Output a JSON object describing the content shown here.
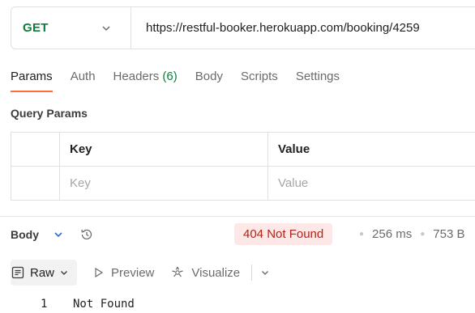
{
  "request": {
    "method": "GET",
    "url": "https://restful-booker.herokuapp.com/booking/4259"
  },
  "request_tabs": [
    {
      "label": "Params",
      "active": true
    },
    {
      "label": "Auth"
    },
    {
      "label": "Headers",
      "count": "(6)"
    },
    {
      "label": "Body"
    },
    {
      "label": "Scripts"
    },
    {
      "label": "Settings"
    }
  ],
  "query_params": {
    "title": "Query Params",
    "columns": [
      "Key",
      "Value"
    ],
    "placeholders": {
      "key": "Key",
      "value": "Value"
    }
  },
  "response": {
    "body_label": "Body",
    "status": "404 Not Found",
    "time": "256 ms",
    "size": "753 B",
    "view_modes": {
      "raw": "Raw",
      "preview": "Preview",
      "visualize": "Visualize"
    },
    "lines": [
      {
        "number": "1",
        "text": "Not Found"
      }
    ]
  },
  "colors": {
    "method_green": "#0f7b3e",
    "accent_orange": "#ff6c37",
    "status_bg": "#fde7e7",
    "status_text": "#b42318"
  },
  "icons": [
    "chevron-down-icon",
    "history-icon",
    "raw-text-icon",
    "play-icon",
    "visualize-icon"
  ]
}
